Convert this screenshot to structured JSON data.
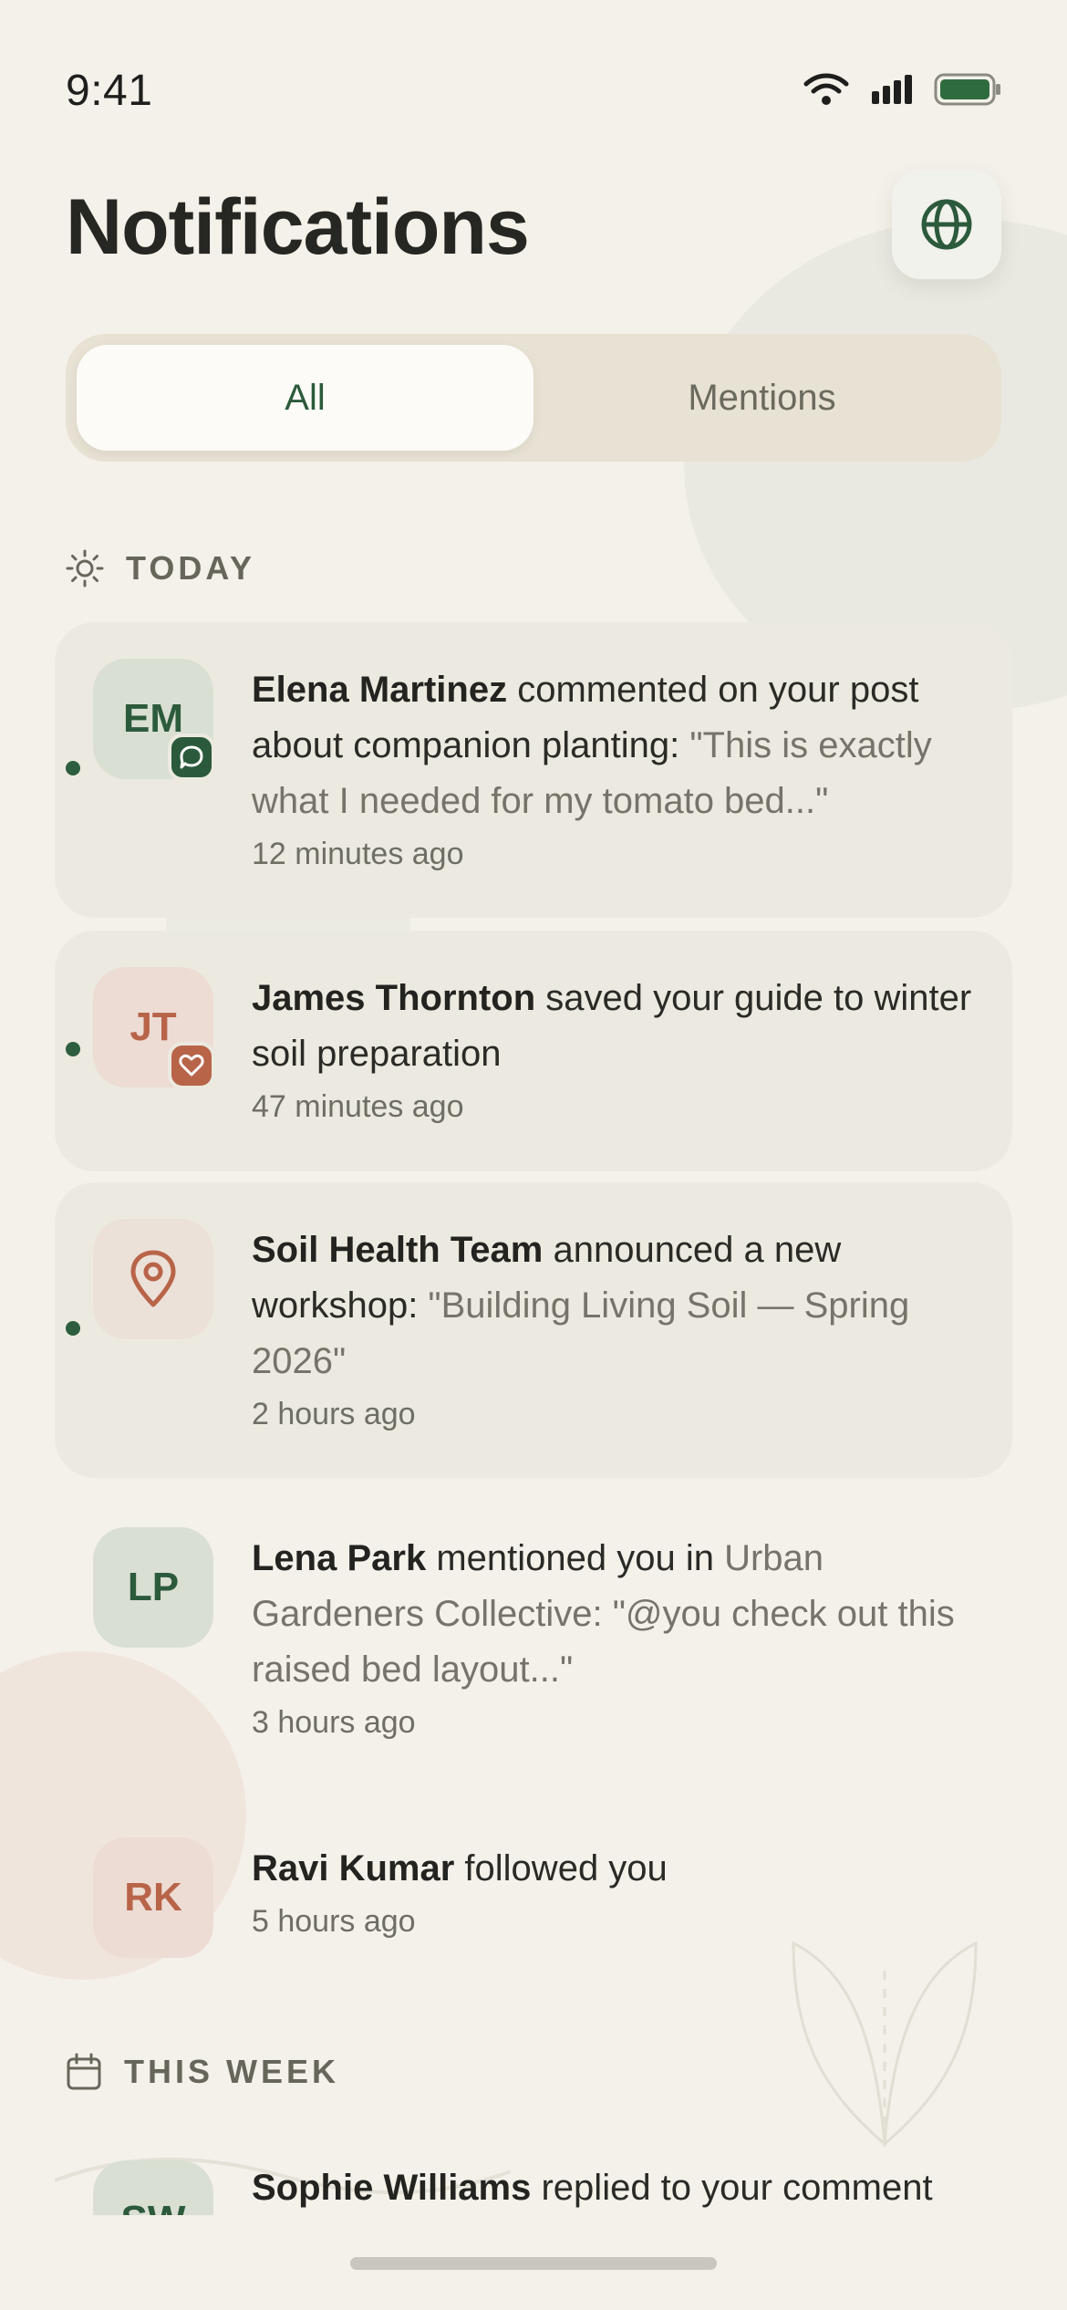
{
  "status_bar": {
    "time": "9:41"
  },
  "header": {
    "title": "Notifications"
  },
  "tabs": [
    {
      "label": "All",
      "active": true
    },
    {
      "label": "Mentions",
      "active": false
    }
  ],
  "sections": {
    "today": "TODAY",
    "this_week": "THIS WEEK"
  },
  "notifications": [
    {
      "initials": "EM",
      "name": "Elena Martinez",
      "action": " commented on your post about companion planting: ",
      "quote": "\"This is exactly what I needed for my tomato bed...\"",
      "time": "12 minutes ago",
      "unread": true,
      "badge_icon": "chat-bubble-icon"
    },
    {
      "initials": "JT",
      "name": "James Thornton",
      "action": " saved your guide to winter soil preparation",
      "time": "47 minutes ago",
      "unread": true,
      "badge_icon": "heart-icon"
    },
    {
      "name": "Soil Health Team",
      "action": " announced a new workshop: ",
      "quote": "\"Building Living Soil — Spring 2026\"",
      "time": "2 hours ago",
      "unread": true,
      "avatar_icon": "location-pin-icon"
    },
    {
      "initials": "LP",
      "name": "Lena Park",
      "action": " mentioned you in ",
      "group": "Urban Gardeners Collective",
      "quote": ": \"@you check out this raised bed layout...\"",
      "time": "3 hours ago",
      "unread": false
    },
    {
      "initials": "RK",
      "name": "Ravi Kumar",
      "action": " followed you",
      "time": "5 hours ago",
      "unread": false
    },
    {
      "initials": "SW",
      "name": "Sophie Williams",
      "action": " replied to your comment",
      "unread": false
    }
  ],
  "colors": {
    "background": "#f4f1ea",
    "accent_green": "#2c5a3c",
    "accent_rose": "#b86449",
    "unread_card": "#eceae0"
  }
}
